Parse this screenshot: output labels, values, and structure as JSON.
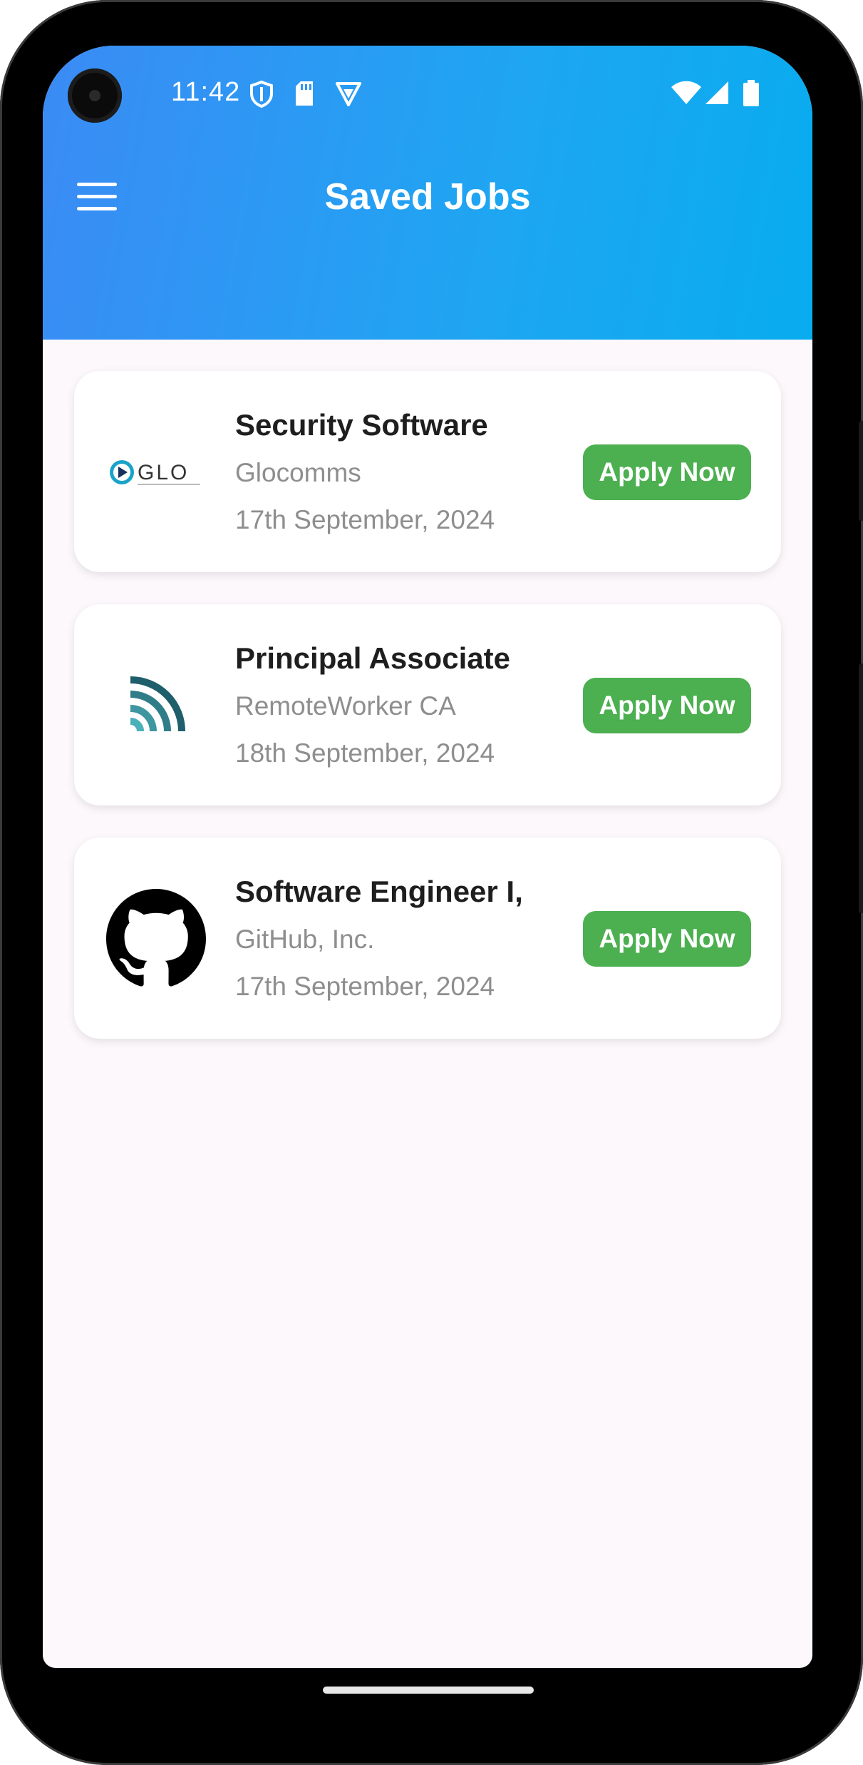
{
  "status_bar": {
    "time": "11:42",
    "left_icons": [
      "shield-icon",
      "sd-card-icon",
      "vpn-icon"
    ],
    "right_icons": [
      "wifi-icon",
      "signal-icon",
      "battery-icon"
    ]
  },
  "app_bar": {
    "title": "Saved Jobs",
    "menu_icon": "hamburger-menu-icon"
  },
  "colors": {
    "header_gradient_start": "#3b8bf5",
    "header_gradient_end": "#08acef",
    "apply_button": "#4caf50",
    "background": "#fdf8fc"
  },
  "jobs": [
    {
      "title": "Security Software",
      "company": "Glocomms",
      "date": "17th September, 2024",
      "action": "Apply Now",
      "logo": "glocomms-logo",
      "logo_text": "GLO"
    },
    {
      "title": "Principal Associate",
      "company": "RemoteWorker CA",
      "date": "18th September, 2024",
      "action": "Apply Now",
      "logo": "remoteworker-logo"
    },
    {
      "title": "Software Engineer I,",
      "company": "GitHub, Inc.",
      "date": "17th September, 2024",
      "action": "Apply Now",
      "logo": "github-logo"
    }
  ]
}
